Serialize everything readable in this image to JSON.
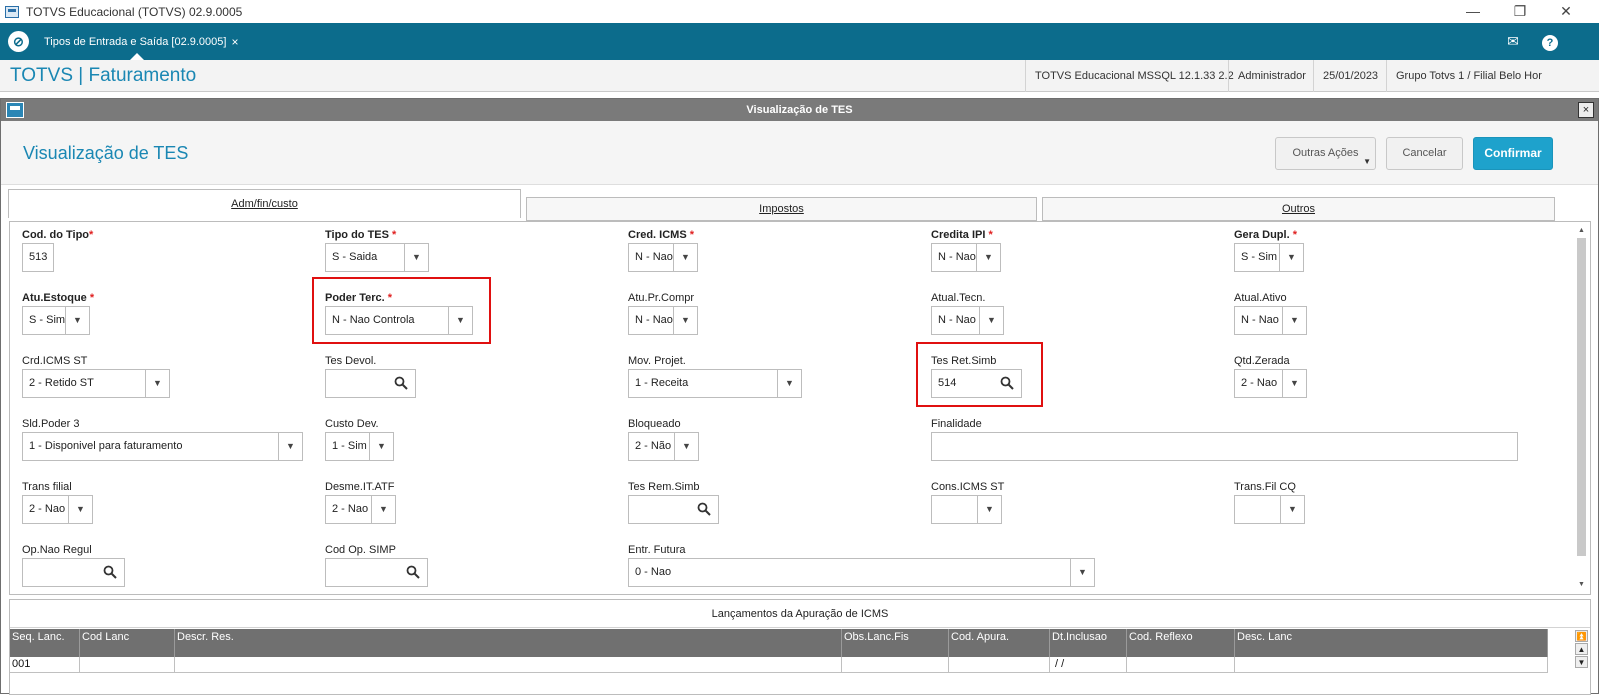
{
  "window": {
    "title": "TOTVS Educacional (TOTVS) 02.9.0005",
    "minimize": "—",
    "maximize": "❐",
    "close": "✕"
  },
  "tabbar": {
    "tab_label": "Tipos de Entrada e Saída [02.9.0005]",
    "tab_close": "×",
    "mail_icon": "✉",
    "help_icon": "?"
  },
  "module": {
    "title": "TOTVS | Faturamento",
    "environment": "TOTVS Educacional MSSQL 12.1.33 2.2",
    "user": "Administrador",
    "date": "25/01/2023",
    "branch": "Grupo Totvs 1 / Filial Belo Hor"
  },
  "dialog": {
    "bar_title": "Visualização de TES",
    "close": "×",
    "page_title": "Visualização de TES",
    "buttons": {
      "other_actions": "Outras Ações",
      "cancel": "Cancelar",
      "confirm": "Confirmar"
    }
  },
  "tabs": [
    "Adm/fin/custo",
    "Impostos",
    "Outros"
  ],
  "fields": {
    "cod_tipo": {
      "label": "Cod. do Tipo",
      "value": "513"
    },
    "tipo_tes": {
      "label": "Tipo do TES",
      "value": "S - Saida"
    },
    "cred_icms": {
      "label": "Cred. ICMS",
      "value": "N - Nao"
    },
    "credita_ipi": {
      "label": "Credita IPI",
      "value": "N - Nao"
    },
    "gera_dupl": {
      "label": "Gera Dupl.",
      "value": "S - Sim"
    },
    "atu_estoque": {
      "label": "Atu.Estoque",
      "value": "S - Sim"
    },
    "poder_terc": {
      "label": "Poder Terc.",
      "value": "N - Nao Controla"
    },
    "atu_pr_compr": {
      "label": "Atu.Pr.Compr",
      "value": "N - Nao"
    },
    "atual_tecn": {
      "label": "Atual.Tecn.",
      "value": "N - Nao"
    },
    "atual_ativo": {
      "label": "Atual.Ativo",
      "value": "N - Nao"
    },
    "crd_icms_st": {
      "label": "Crd.ICMS ST",
      "value": "2 - Retido ST"
    },
    "tes_devol": {
      "label": "Tes Devol.",
      "value": ""
    },
    "mov_projet": {
      "label": "Mov. Projet.",
      "value": "1 - Receita"
    },
    "tes_ret_simb": {
      "label": "Tes Ret.Simb",
      "value": "514"
    },
    "qtd_zerada": {
      "label": "Qtd.Zerada",
      "value": "2 - Nao"
    },
    "sld_poder3": {
      "label": "Sld.Poder 3",
      "value": "1 - Disponivel para faturamento"
    },
    "custo_dev": {
      "label": "Custo Dev.",
      "value": "1 - Sim"
    },
    "bloqueado": {
      "label": "Bloqueado",
      "value": "2 - Não"
    },
    "finalidade": {
      "label": "Finalidade",
      "value": ""
    },
    "trans_filial": {
      "label": "Trans filial",
      "value": "2 - Nao"
    },
    "desme_it_atf": {
      "label": "Desme.IT.ATF",
      "value": "2 - Nao"
    },
    "tes_rem_simb": {
      "label": "Tes Rem.Simb",
      "value": ""
    },
    "cons_icms_st": {
      "label": "Cons.ICMS ST",
      "value": ""
    },
    "trans_fil_cq": {
      "label": "Trans.Fil CQ",
      "value": ""
    },
    "op_nao_regul": {
      "label": "Op.Nao Regul",
      "value": ""
    },
    "cod_op_simp": {
      "label": "Cod Op. SIMP",
      "value": ""
    },
    "entr_futura": {
      "label": "Entr. Futura",
      "value": "0 - Nao"
    }
  },
  "required_mark": "*",
  "grid": {
    "title": "Lançamentos da Apuração de ICMS",
    "columns": [
      "Seq. Lanc.",
      "Cod Lanc",
      "Descr. Res.",
      "Obs.Lanc.Fis",
      "Cod. Apura.",
      "Dt.Inclusao",
      "Cod. Reflexo",
      "Desc. Lanc"
    ],
    "rows": [
      [
        "001",
        "",
        "",
        "",
        "",
        " / /",
        "",
        ""
      ]
    ]
  },
  "colors": {
    "brand_teal": "#0c6c8c",
    "title_blue": "#1a87b3",
    "confirm_blue": "#1ea2cc",
    "highlight_red": "#e01010"
  }
}
